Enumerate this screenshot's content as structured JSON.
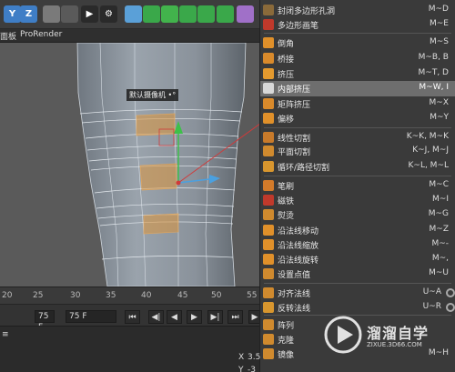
{
  "toolbar": {
    "buttons": [
      {
        "name": "axis-y-icon",
        "glyph": "Y",
        "color": "#3f7ec6"
      },
      {
        "name": "axis-z-icon",
        "glyph": "Z",
        "color": "#3f7ec6"
      },
      {
        "name": "coordinate-system-icon",
        "glyph": "",
        "color": "#7a7a7a"
      },
      {
        "name": "render-region-icon",
        "glyph": "",
        "color": "#5a5a5a"
      },
      {
        "name": "render-view-icon",
        "glyph": "▶",
        "color": "#2a2a2a"
      },
      {
        "name": "render-settings-icon",
        "glyph": "⚙",
        "color": "#2a2a2a"
      },
      {
        "name": "cube-icon",
        "glyph": "",
        "color": "#5aa0d8"
      },
      {
        "name": "pen-spline-icon",
        "glyph": "",
        "color": "#3aa84a"
      },
      {
        "name": "subdivision-icon",
        "glyph": "",
        "color": "#42b34c"
      },
      {
        "name": "cloner-icon",
        "glyph": "",
        "color": "#3aa84a"
      },
      {
        "name": "deformer-icon",
        "glyph": "",
        "color": "#3aa84a"
      },
      {
        "name": "environment-icon",
        "glyph": "",
        "color": "#3aa84a"
      },
      {
        "name": "camera-icon",
        "glyph": "",
        "color": "#a070c8"
      }
    ]
  },
  "menubar": {
    "items": [
      "面板",
      "ProRender"
    ]
  },
  "viewport": {
    "camera_label": "默认摄像机 •°"
  },
  "timeline": {
    "ticks": [
      "20",
      "25",
      "30",
      "35",
      "40",
      "45",
      "50",
      "55"
    ],
    "current_frame": "75 F",
    "end_frame": "75 F"
  },
  "bottom": {
    "x_label": "X",
    "x_value": "3.5",
    "y_label": "Y",
    "y_value": "-3"
  },
  "menu": {
    "items": [
      {
        "label": "封闭多边形孔洞",
        "shortcut": "M~D",
        "icon": "#8a6a3a",
        "highlight": false,
        "gear": false
      },
      {
        "label": "多边形画笔",
        "shortcut": "M~E",
        "icon": "#c0392b",
        "highlight": false,
        "gear": false
      },
      {
        "label": "倒角",
        "shortcut": "M~S",
        "icon": "#e0902a",
        "highlight": false,
        "gear": false
      },
      {
        "label": "桥接",
        "shortcut": "M~B, B",
        "icon": "#d98a2b",
        "highlight": false,
        "gear": false
      },
      {
        "label": "挤压",
        "shortcut": "M~T, D",
        "icon": "#e49a2e",
        "highlight": false,
        "gear": false
      },
      {
        "label": "内部挤压",
        "shortcut": "M~W, I",
        "icon": "#d8d8d8",
        "highlight": true,
        "gear": false
      },
      {
        "label": "矩阵挤压",
        "shortcut": "M~X",
        "icon": "#d98a2b",
        "highlight": false,
        "gear": false
      },
      {
        "label": "偏移",
        "shortcut": "M~Y",
        "icon": "#e0902a",
        "highlight": false,
        "gear": false
      },
      {
        "label": "线性切割",
        "shortcut": "K~K, M~K",
        "icon": "#c87a2a",
        "highlight": false,
        "gear": false
      },
      {
        "label": "平面切割",
        "shortcut": "K~J, M~J",
        "icon": "#d08a2e",
        "highlight": false,
        "gear": false
      },
      {
        "label": "循环/路径切割",
        "shortcut": "K~L, M~L",
        "icon": "#d8962e",
        "highlight": false,
        "gear": false
      },
      {
        "label": "笔刷",
        "shortcut": "M~C",
        "icon": "#d27a2a",
        "highlight": false,
        "gear": false
      },
      {
        "label": "磁铁",
        "shortcut": "M~I",
        "icon": "#c0392b",
        "highlight": false,
        "gear": false
      },
      {
        "label": "熨烫",
        "shortcut": "M~G",
        "icon": "#d08a2e",
        "highlight": false,
        "gear": false
      },
      {
        "label": "沿法线移动",
        "shortcut": "M~Z",
        "icon": "#e0902a",
        "highlight": false,
        "gear": false
      },
      {
        "label": "沿法线缩放",
        "shortcut": "M~-",
        "icon": "#e0902a",
        "highlight": false,
        "gear": false
      },
      {
        "label": "沿法线旋转",
        "shortcut": "M~,",
        "icon": "#e0902a",
        "highlight": false,
        "gear": false
      },
      {
        "label": "设置点值",
        "shortcut": "M~U",
        "icon": "#d08a2e",
        "highlight": false,
        "gear": false
      },
      {
        "label": "对齐法线",
        "shortcut": "U~A",
        "icon": "#d08a2e",
        "highlight": false,
        "gear": true
      },
      {
        "label": "反转法线",
        "shortcut": "U~R",
        "icon": "#d8962e",
        "highlight": false,
        "gear": true
      },
      {
        "label": "阵列",
        "shortcut": "",
        "icon": "#d08a2e",
        "highlight": false,
        "gear": false
      },
      {
        "label": "克隆",
        "shortcut": "",
        "icon": "#d08a2e",
        "highlight": false,
        "gear": false
      },
      {
        "label": "镜像",
        "shortcut": "M~H",
        "icon": "#d08a2e",
        "highlight": false,
        "gear": false
      }
    ]
  },
  "watermark": {
    "text": "溜溜自学",
    "sub": "ZIXUE.3D66.COM"
  }
}
